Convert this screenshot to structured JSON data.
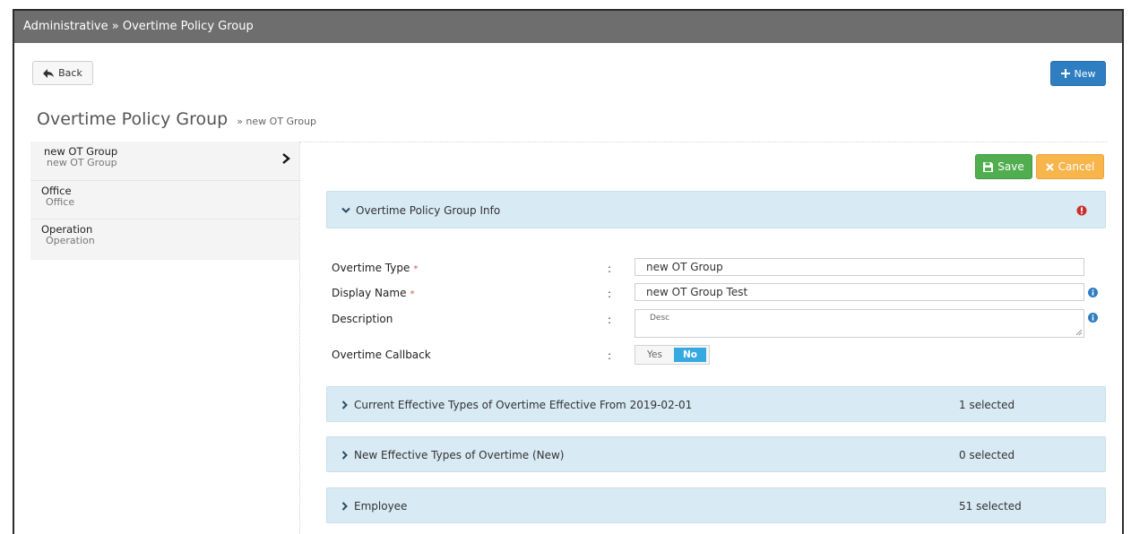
{
  "header": {
    "breadcrumb": "Administrative » Overtime Policy Group"
  },
  "toolbar": {
    "back_label": "Back",
    "new_label": "New"
  },
  "page": {
    "title": "Overtime Policy Group",
    "subtitle": "» new OT Group"
  },
  "sidebar": {
    "items": [
      {
        "label": "new OT Group",
        "sub": "new OT Group",
        "active": true
      },
      {
        "label": "Office",
        "sub": "Office"
      },
      {
        "label": "Operation",
        "sub": "Operation"
      }
    ]
  },
  "actions": {
    "save_label": "Save",
    "cancel_label": "Cancel"
  },
  "info_panel": {
    "title": "Overtime Policy Group Info"
  },
  "form": {
    "overtime_type": {
      "label": "Overtime Type",
      "required_mark": "*",
      "value": "new OT Group"
    },
    "display_name": {
      "label": "Display Name",
      "required_mark": "*",
      "value": "new OT Group Test"
    },
    "description": {
      "label": "Description",
      "placeholder": "Desc"
    },
    "callback": {
      "label": "Overtime Callback",
      "yes_label": "Yes",
      "no_label": "No",
      "selected": "No"
    },
    "colon": ":"
  },
  "sections": [
    {
      "title": "Current Effective Types of Overtime Effective From 2019-02-01",
      "count": "1 selected"
    },
    {
      "title": "New Effective Types of Overtime (New)",
      "count": "0 selected"
    },
    {
      "title": "Employee",
      "count": "51 selected"
    }
  ],
  "icons": {
    "back": "arrow-left-icon",
    "new": "plus-icon",
    "save": "floppy-disk-icon",
    "cancel": "x-icon",
    "collapse": "chevron-down-icon",
    "expand": "chevron-right-icon",
    "warning": "exclamation-circle-icon",
    "info": "info-circle-icon"
  },
  "colors": {
    "titlebar": "#6e6e6e",
    "primary": "#2f7ec1",
    "success": "#51ae4f",
    "warning": "#f7b54c",
    "panel": "#d8eaf4",
    "toggle_on": "#36a9e1",
    "required": "#d9534f"
  }
}
